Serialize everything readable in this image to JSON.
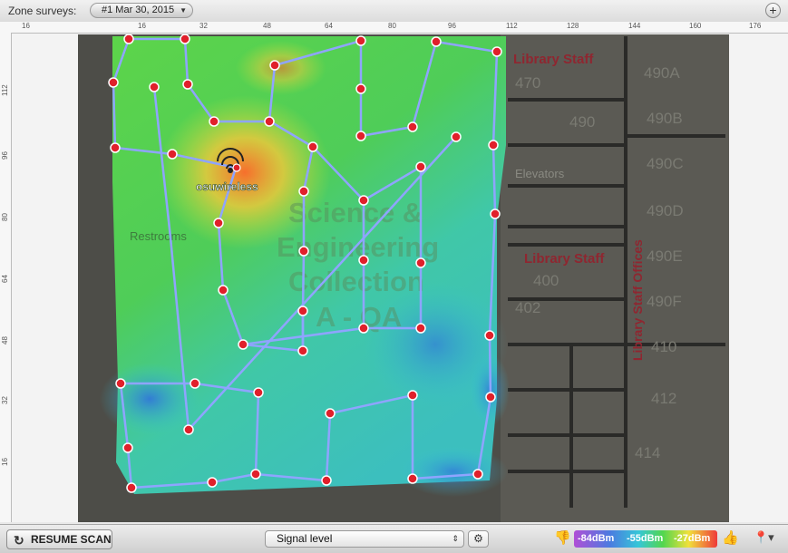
{
  "topbar": {
    "label": "Zone surveys:",
    "survey": "#1 Mar 30, 2015",
    "add_icon": "plus-icon"
  },
  "ruler_top": [
    "16",
    "16",
    "32",
    "48",
    "64",
    "80",
    "96",
    "112",
    "128",
    "144",
    "160",
    "176"
  ],
  "ruler_left": [
    "112",
    "96",
    "80",
    "64",
    "48",
    "32",
    "16"
  ],
  "map": {
    "network_label": "osuwireless",
    "rooms": [
      "Library Staff",
      "470",
      "490",
      "490A",
      "490B",
      "490C",
      "490D",
      "490E",
      "490F",
      "Elevators",
      "Library Staff",
      "400",
      "402",
      "410",
      "412",
      "414",
      "Library Staff Offices"
    ],
    "watermark": [
      "Science &",
      "Engineering",
      "Collection",
      "A - QA"
    ],
    "restrooms": "Restrooms"
  },
  "bottombar": {
    "resume_label": "RESUME SCAN",
    "view_select": "Signal level",
    "legend": [
      "-84dBm",
      "-55dBm",
      "-27dBm"
    ]
  },
  "colors": {
    "accent_green": "#52d64e",
    "pin_red": "#e0202b",
    "path_blue": "#8fa4ff"
  }
}
